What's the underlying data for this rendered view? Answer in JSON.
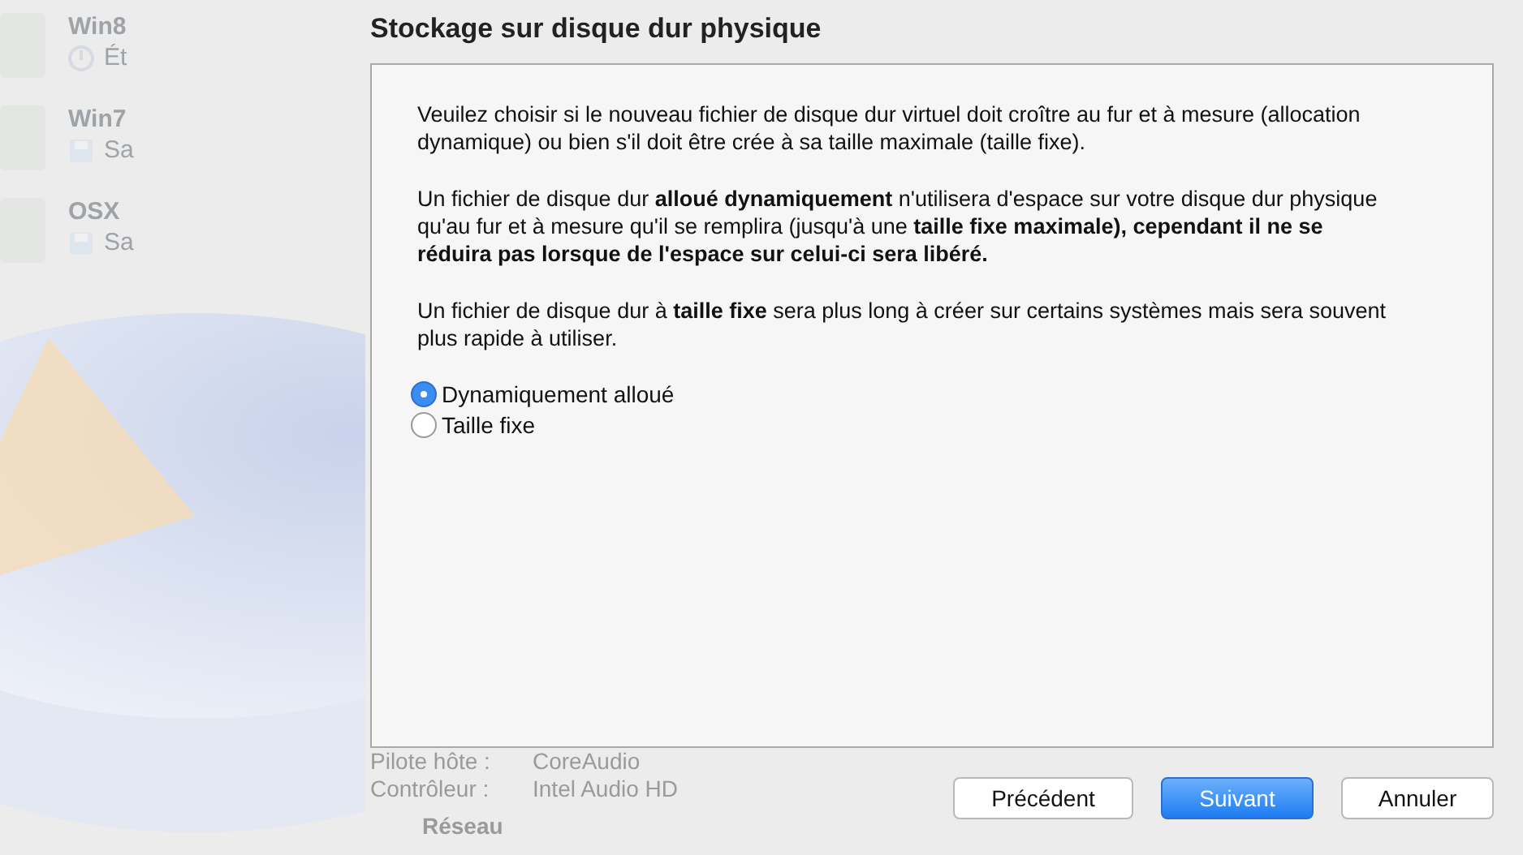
{
  "background": {
    "sidebar_items": [
      {
        "name": "Win8",
        "status": "Ét",
        "kind": "power"
      },
      {
        "name": "Win7",
        "status": "Sa",
        "kind": "saved"
      },
      {
        "name": "OSX",
        "status": "Sa",
        "kind": "saved"
      }
    ],
    "details": [
      {
        "label": "Pilote hôte :",
        "value": "CoreAudio"
      },
      {
        "label": "Contrôleur :",
        "value": "Intel Audio HD"
      }
    ],
    "section": "Réseau"
  },
  "dialog": {
    "title": "Stockage sur disque dur physique",
    "paragraphs": [
      "Veuilez choisir si le nouveau fichier de disque dur virtuel doit croître au fur et à mesure (allocation dynamique) ou bien s'il doit être crée à sa taille maximale (taille fixe).",
      "Un fichier de disque dur **alloué dynamiquement** n'utilisera d'espace sur votre disque dur physique qu'au fur et à mesure qu'il se remplira (jusqu'à une **taille fixe maximale), cependant il ne se réduira pas lorsque de l'espace sur celui-ci sera libéré.**",
      "Un fichier de disque dur à **taille fixe** sera plus long à créer sur certains systèmes mais sera souvent plus rapide à utiliser."
    ],
    "options": [
      {
        "label": "Dynamiquement alloué",
        "selected": true
      },
      {
        "label": "Taille fixe",
        "selected": false
      }
    ],
    "buttons": [
      {
        "label": "Précédent",
        "kind": "normal"
      },
      {
        "label": "Suivant",
        "kind": "default"
      },
      {
        "label": "Annuler",
        "kind": "normal"
      }
    ]
  }
}
